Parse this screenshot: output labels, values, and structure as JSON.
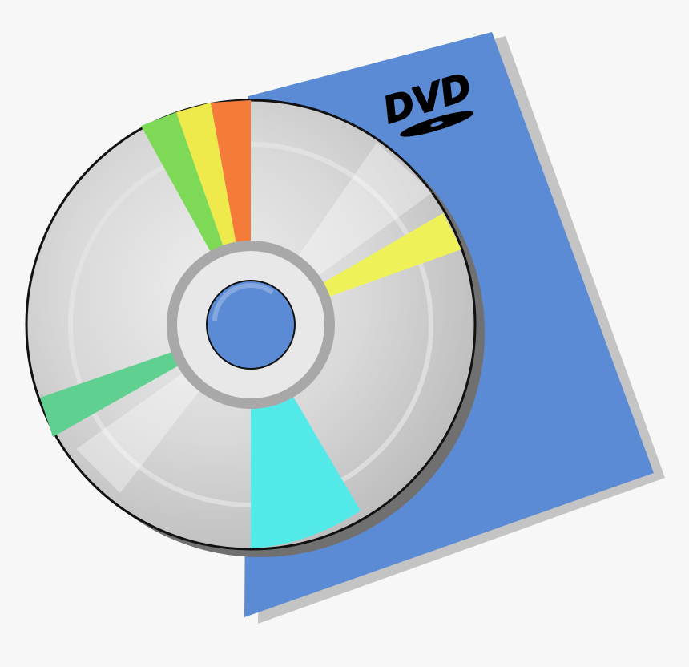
{
  "background_color": "#f7f7f7",
  "case": {
    "logo_text": "DVD",
    "color": "#5b8bd5",
    "shadow_color": "#c4c4c4"
  },
  "disc": {
    "hole_color": "#5b8bd5",
    "surface_color": "#cfcfcf",
    "rainbow_colors": [
      "#7ed957",
      "#eeea4b",
      "#f47b3a",
      "#eef158",
      "#5fd08f",
      "#53e9e9"
    ]
  }
}
